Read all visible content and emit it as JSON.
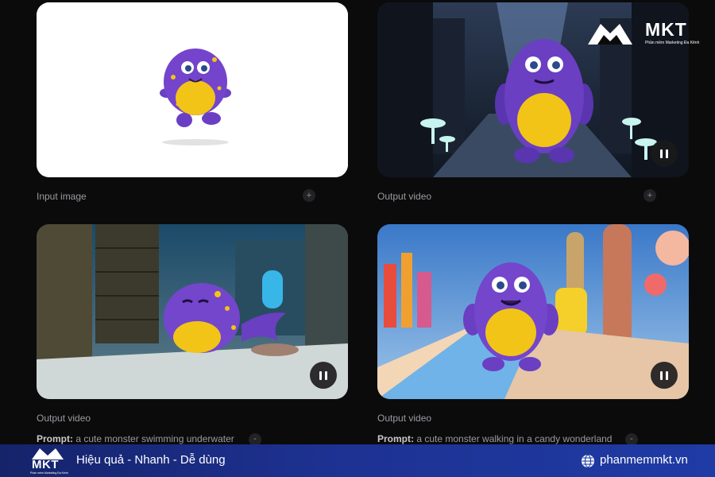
{
  "panels": [
    {
      "caption": "Input image",
      "action_icon": "plus-icon"
    },
    {
      "caption": "Output video",
      "action_icon": "plus-icon",
      "control_icon": "pause-icon"
    },
    {
      "caption": "Output video",
      "prompt_label": "Prompt:",
      "prompt_text": " a cute monster swimming underwater",
      "action_icon": "minus-icon",
      "control_icon": "pause-icon"
    },
    {
      "caption": "Output video",
      "prompt_label": "Prompt:",
      "prompt_text": " a cute monster walking in a candy wonderland",
      "action_icon": "minus-icon",
      "control_icon": "pause-icon"
    }
  ],
  "buttons": {
    "plus": "+",
    "minus": "-"
  },
  "watermark": {
    "brand": "MKT",
    "tagline": "Phần mềm Marketing Đa Kênh"
  },
  "banner": {
    "brand": "MKT",
    "brand_tagline": "Phần mềm Marketing Đa Kênh",
    "slogan": "Hiệu quả - Nhanh - Dễ dùng",
    "website": "phanmemmkt.vn",
    "icon": "globe-icon"
  },
  "colors": {
    "background": "#0b0b0c",
    "banner_start": "#15236a",
    "banner_end": "#1f3ba5",
    "monster_purple": "#6b3fc4",
    "monster_belly": "#f2c418"
  }
}
